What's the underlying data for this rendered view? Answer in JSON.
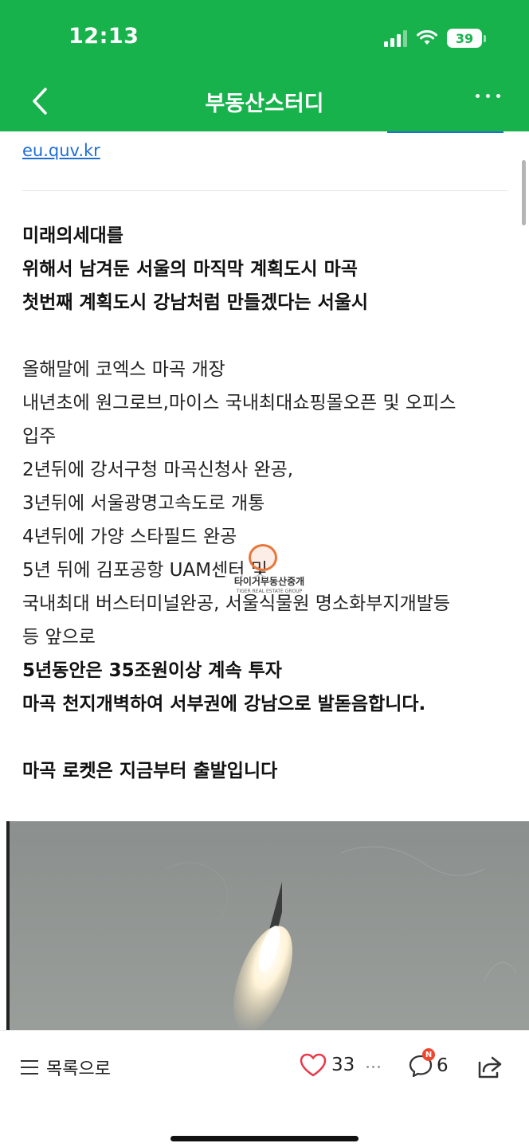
{
  "status_bar": {
    "time": "12:13",
    "battery": "39"
  },
  "nav": {
    "title": "부동산스터디"
  },
  "content": {
    "top_link": "eu.quv.kr",
    "lines": [
      "미래의세대를",
      "위해서 남겨둔 서울의 마직막 계획도시 마곡",
      "첫번째 계획도시 강남처럼 만들겠다는 서울시",
      "올해말에 코엑스 마곡 개장",
      "내년초에 원그로브,마이스 국내최대쇼핑몰오픈 및 오피스",
      "입주",
      "2년뒤에 강서구청 마곡신청사 완공,",
      "3년뒤에 서울광명고속도로 개통",
      "4년뒤에 가양 스타필드 완공",
      "5년 뒤에 김포공항 UAM센터 및",
      "국내최대 버스터미널완공, 서울식물원 명소화부지개발등",
      "등 앞으로",
      "5년동안은 35조원이상 계속 투자",
      "마곡 천지개벽하여 서부권에 강남으로 발돋음합니다.",
      "마곡 로켓은 지금부터 출발입니다"
    ],
    "watermark": {
      "title": "타이거부동산중개",
      "subtitle": "TIGER REAL ESTATE GROUP"
    }
  },
  "bottom_bar": {
    "list_label": "목록으로",
    "like_count": "33",
    "comment_count": "6",
    "comment_badge": "N"
  },
  "colors": {
    "header_green": "#18b24d",
    "link_blue": "#1f6fd1",
    "like_red": "#e8394a",
    "badge_red": "#f0462e"
  }
}
